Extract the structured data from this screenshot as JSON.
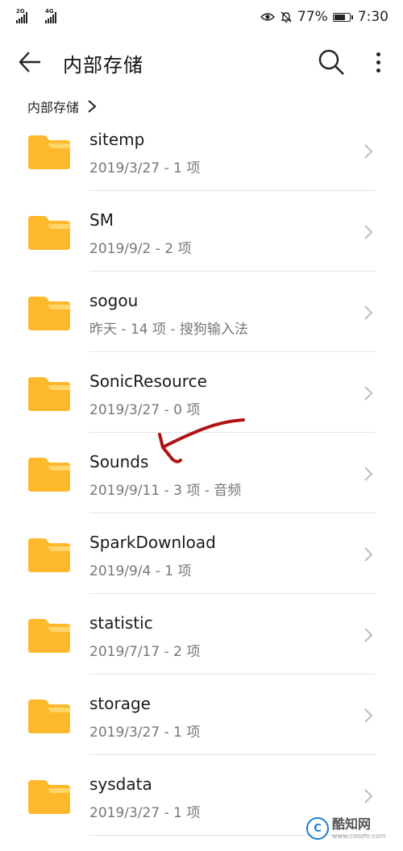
{
  "status_bar": {
    "network_1": "2G",
    "network_2": "4G",
    "battery": "77%",
    "time": "7:30",
    "battery_level": 0.77
  },
  "app_bar": {
    "title": "内部存储",
    "back_icon": "arrow-left-icon",
    "search_icon": "search-icon",
    "more_icon": "more-vertical-icon"
  },
  "breadcrumb": {
    "label": "内部存储"
  },
  "folders": [
    {
      "name": "sitemp",
      "meta": "2019/3/27 - 1 项"
    },
    {
      "name": "SM",
      "meta": "2019/9/2 - 2 项"
    },
    {
      "name": "sogou",
      "meta": "昨天 - 14 项 - 搜狗输入法"
    },
    {
      "name": "SonicResource",
      "meta": "2019/3/27 - 0 项"
    },
    {
      "name": "Sounds",
      "meta": "2019/9/11 - 3 项 - 音频"
    },
    {
      "name": "SparkDownload",
      "meta": "2019/9/4 - 1 项"
    },
    {
      "name": "statistic",
      "meta": "2019/7/17 - 2 项"
    },
    {
      "name": "storage",
      "meta": "2019/3/27 - 1 项"
    },
    {
      "name": "sysdata",
      "meta": "2019/3/27 - 1 项"
    }
  ],
  "watermark": {
    "logo_text": "C",
    "name": "酷知网",
    "url": "www.coozhi.com"
  },
  "colors": {
    "folder": "#FDB92B",
    "folder_tab": "#FFD66B",
    "annotation": "#B01414"
  }
}
